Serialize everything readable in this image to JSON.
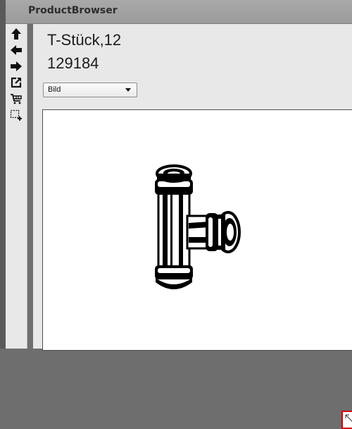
{
  "window": {
    "title": "ProductBrowser"
  },
  "toolbar": {
    "icons": [
      "arrow-up-icon",
      "arrow-left-icon",
      "arrow-right-icon",
      "external-link-icon",
      "cart-icon",
      "add-selection-icon"
    ]
  },
  "product": {
    "name": "T-Stück,12",
    "number": "129184"
  },
  "view_select": {
    "selected": "Bild"
  },
  "colors": {
    "highlight": "#d40000",
    "titlebar": "#a0a0a0",
    "panel": "#e8e8e8"
  }
}
